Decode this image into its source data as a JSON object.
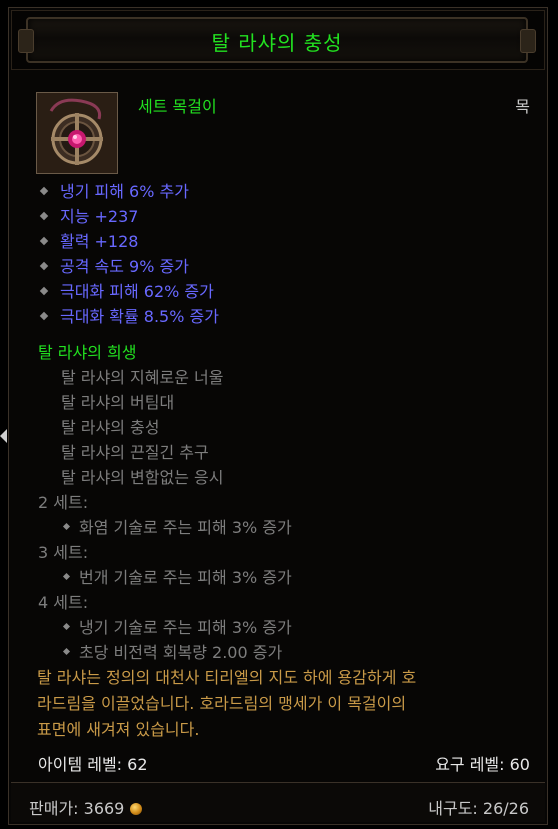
{
  "header": {
    "title": "탈 라샤의 충성"
  },
  "item": {
    "icon": "amulet-icon",
    "type": "세트 목걸이",
    "slot": "목"
  },
  "stats": [
    "냉기 피해 6% 추가",
    "지능 +237",
    "활력 +128",
    "공격 속도 9% 증가",
    "극대화 피해 62% 증가",
    "극대화 확률 8.5% 증가"
  ],
  "set": {
    "name": "탈 라샤의 희생",
    "items": [
      "탈 라샤의 지혜로운 너울",
      "탈 라샤의 버팀대",
      "탈 라샤의 충성",
      "탈 라샤의 끈질긴 추구",
      "탈 라샤의 변함없는 응시"
    ],
    "tiers": [
      {
        "label": "2 세트:",
        "bonuses": [
          "화염 기술로 주는 피해 3% 증가"
        ]
      },
      {
        "label": "3 세트:",
        "bonuses": [
          "번개 기술로 주는 피해 3% 증가"
        ]
      },
      {
        "label": "4 세트:",
        "bonuses": [
          "냉기 기술로 주는 피해 3% 증가",
          "초당 비전력 회복량 2.00 증가"
        ]
      }
    ]
  },
  "flavor": [
    "탈 라샤는 정의의 대천사 티리엘의 지도 하에 용감하게 호",
    "라드림을 이끌었습니다. 호라드림의 맹세가 이 목걸이의",
    "표면에 새겨져 있습니다."
  ],
  "levels": {
    "item_level": "아이템 레벨: 62",
    "required_level": "요구 레벨: 60"
  },
  "footer": {
    "price": "판매가: 3669",
    "durability": "내구도: 26/26"
  },
  "colors": {
    "set_green": "#22e020",
    "magic_blue": "#6868ff",
    "flavor_gold": "#c99a48",
    "inactive_gray": "#7d7d7d"
  }
}
